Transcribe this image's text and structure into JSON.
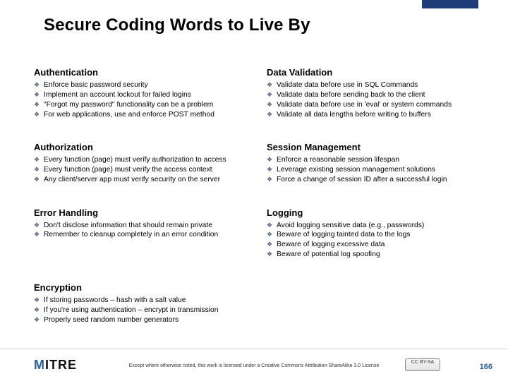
{
  "title": "Secure Coding Words to Live By",
  "sections": [
    {
      "heading": "Authentication",
      "items": [
        "Enforce basic password security",
        "Implement an account lockout for failed logins",
        "\"Forgot my password\" functionality can be a problem",
        "For web applications, use and enforce POST method"
      ]
    },
    {
      "heading": "Data Validation",
      "items": [
        "Validate data before use in SQL Commands",
        "Validate data before sending back to the client",
        "Validate data before use in 'eval' or system commands",
        "Validate all data lengths before writing to buffers"
      ]
    },
    {
      "heading": "Authorization",
      "items": [
        "Every function (page) must verify authorization to access",
        "Every function (page) must verify the access context",
        "Any client/server app must verify security on the server"
      ]
    },
    {
      "heading": "Session Management",
      "items": [
        "Enforce a reasonable session lifespan",
        "Leverage existing session management solutions",
        "Force a change of session ID after a successful login"
      ]
    },
    {
      "heading": "Error Handling",
      "items": [
        "Don't disclose information that should remain private",
        "Remember to cleanup completely in an error condition"
      ]
    },
    {
      "heading": "Logging",
      "items": [
        "Avoid logging sensitive data (e.g., passwords)",
        "Beware of logging tainted data to the logs",
        "Beware of logging excessive data",
        "Beware of potential log spoofing"
      ]
    },
    {
      "heading": "Encryption",
      "items": [
        "If storing passwords – hash with a salt value",
        "If you're using authentication – encrypt in transmission",
        "Properly seed random number generators"
      ]
    }
  ],
  "footer": {
    "logo_text_a": "M",
    "logo_text_b": "ITRE",
    "license_text": "Except where otherwise noted, this work is licensed under a Creative Commons Attribution-ShareAlike 3.0 License",
    "cc_badge": "CC BY-SA",
    "page_number": "166"
  }
}
